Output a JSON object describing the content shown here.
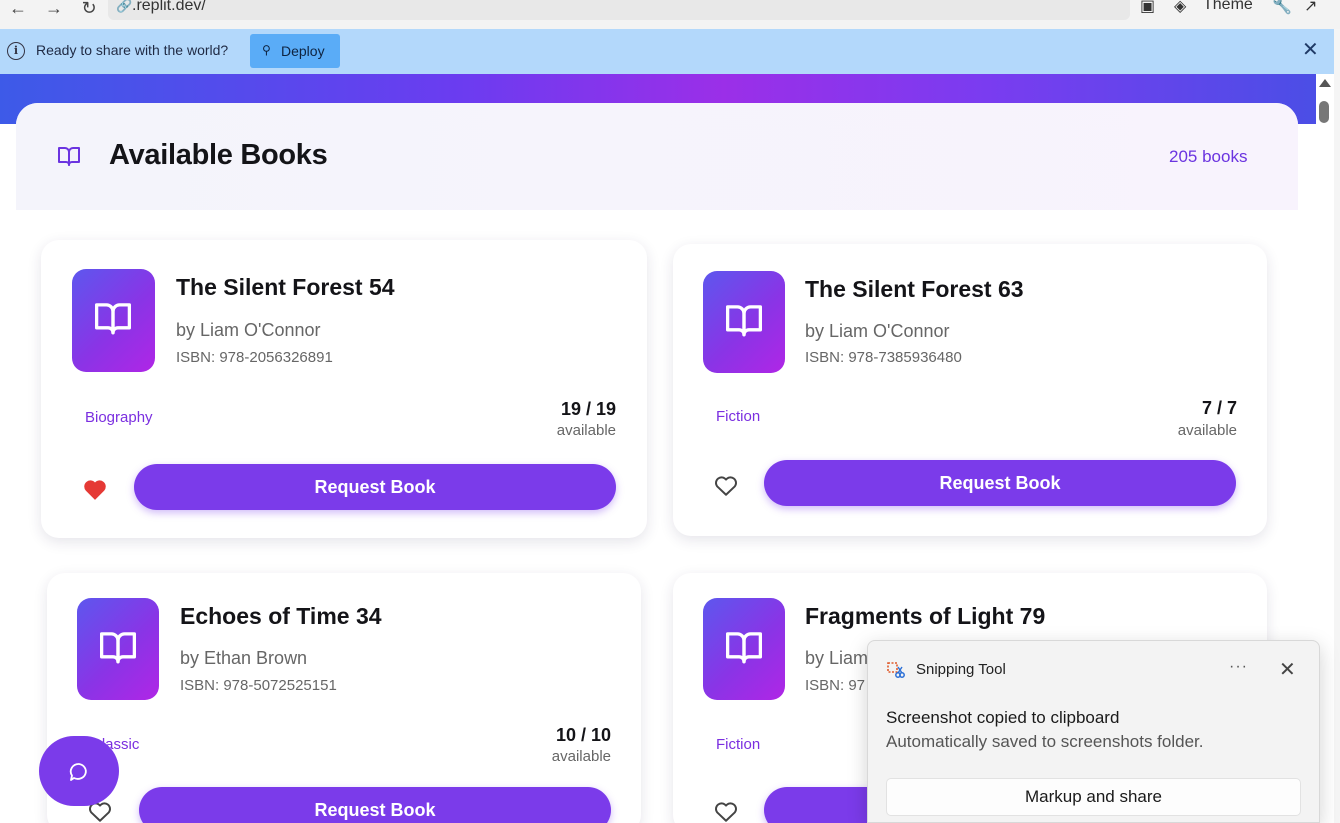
{
  "browser": {
    "url": ".replit.dev/",
    "theme_label": "Theme"
  },
  "banner": {
    "message": "Ready to share with the world?",
    "deploy_label": "Deploy"
  },
  "app": {
    "title": "Available Books",
    "book_count": "205 books",
    "request_label": "Request Book",
    "available_label": "available"
  },
  "books": [
    {
      "title": "The Silent Forest 54",
      "author": "by Liam O'Connor",
      "isbn": "ISBN: 978-2056326891",
      "genre": "Biography",
      "availability": "19 / 19",
      "favorited": true
    },
    {
      "title": "The Silent Forest 63",
      "author": "by Liam O'Connor",
      "isbn": "ISBN: 978-7385936480",
      "genre": "Fiction",
      "availability": "7 / 7",
      "favorited": false
    },
    {
      "title": "Echoes of Time 34",
      "author": "by Ethan Brown",
      "isbn": "ISBN: 978-5072525151",
      "genre": "Classic",
      "availability": "10 / 10",
      "favorited": false
    },
    {
      "title": "Fragments of Light 79",
      "author": "by Liam",
      "isbn": "ISBN: 97",
      "genre": "Fiction",
      "availability": "",
      "favorited": false
    }
  ],
  "snipping_tool": {
    "app_name": "Snipping Tool",
    "message": "Screenshot copied to clipboard",
    "sub_message": "Automatically saved to screenshots folder.",
    "action_label": "Markup and share"
  },
  "colors": {
    "accent": "#7b3bea",
    "banner_bg": "#b3d8fb",
    "heart_active": "#e53935"
  }
}
